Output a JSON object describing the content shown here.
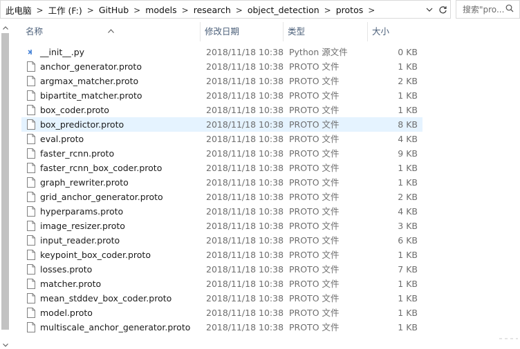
{
  "address_bar": {
    "breadcrumbs": [
      "此电脑",
      "工作 (F:)",
      "GitHub",
      "models",
      "research",
      "object_detection",
      "protos"
    ],
    "separator": ">"
  },
  "search": {
    "placeholder": "搜索\"pro..."
  },
  "columns": {
    "name": "名称",
    "date": "修改日期",
    "type": "类型",
    "size": "大小"
  },
  "files": [
    {
      "name": "__init__.py",
      "date": "2018/11/18 10:38",
      "type": "Python 源文件",
      "size": "0 KB",
      "icon": "python-file-icon"
    },
    {
      "name": "anchor_generator.proto",
      "date": "2018/11/18 10:38",
      "type": "PROTO 文件",
      "size": "1 KB",
      "icon": "file-icon"
    },
    {
      "name": "argmax_matcher.proto",
      "date": "2018/11/18 10:38",
      "type": "PROTO 文件",
      "size": "2 KB",
      "icon": "file-icon"
    },
    {
      "name": "bipartite_matcher.proto",
      "date": "2018/11/18 10:38",
      "type": "PROTO 文件",
      "size": "1 KB",
      "icon": "file-icon"
    },
    {
      "name": "box_coder.proto",
      "date": "2018/11/18 10:38",
      "type": "PROTO 文件",
      "size": "1 KB",
      "icon": "file-icon"
    },
    {
      "name": "box_predictor.proto",
      "date": "2018/11/18 10:38",
      "type": "PROTO 文件",
      "size": "8 KB",
      "icon": "file-icon",
      "selected": true
    },
    {
      "name": "eval.proto",
      "date": "2018/11/18 10:38",
      "type": "PROTO 文件",
      "size": "4 KB",
      "icon": "file-icon"
    },
    {
      "name": "faster_rcnn.proto",
      "date": "2018/11/18 10:38",
      "type": "PROTO 文件",
      "size": "9 KB",
      "icon": "file-icon"
    },
    {
      "name": "faster_rcnn_box_coder.proto",
      "date": "2018/11/18 10:38",
      "type": "PROTO 文件",
      "size": "1 KB",
      "icon": "file-icon"
    },
    {
      "name": "graph_rewriter.proto",
      "date": "2018/11/18 10:38",
      "type": "PROTO 文件",
      "size": "1 KB",
      "icon": "file-icon"
    },
    {
      "name": "grid_anchor_generator.proto",
      "date": "2018/11/18 10:38",
      "type": "PROTO 文件",
      "size": "2 KB",
      "icon": "file-icon"
    },
    {
      "name": "hyperparams.proto",
      "date": "2018/11/18 10:38",
      "type": "PROTO 文件",
      "size": "4 KB",
      "icon": "file-icon"
    },
    {
      "name": "image_resizer.proto",
      "date": "2018/11/18 10:38",
      "type": "PROTO 文件",
      "size": "3 KB",
      "icon": "file-icon"
    },
    {
      "name": "input_reader.proto",
      "date": "2018/11/18 10:38",
      "type": "PROTO 文件",
      "size": "6 KB",
      "icon": "file-icon"
    },
    {
      "name": "keypoint_box_coder.proto",
      "date": "2018/11/18 10:38",
      "type": "PROTO 文件",
      "size": "1 KB",
      "icon": "file-icon"
    },
    {
      "name": "losses.proto",
      "date": "2018/11/18 10:38",
      "type": "PROTO 文件",
      "size": "7 KB",
      "icon": "file-icon"
    },
    {
      "name": "matcher.proto",
      "date": "2018/11/18 10:38",
      "type": "PROTO 文件",
      "size": "1 KB",
      "icon": "file-icon"
    },
    {
      "name": "mean_stddev_box_coder.proto",
      "date": "2018/11/18 10:38",
      "type": "PROTO 文件",
      "size": "1 KB",
      "icon": "file-icon"
    },
    {
      "name": "model.proto",
      "date": "2018/11/18 10:38",
      "type": "PROTO 文件",
      "size": "1 KB",
      "icon": "file-icon"
    },
    {
      "name": "multiscale_anchor_generator.proto",
      "date": "2018/11/18 10:38",
      "type": "PROTO 文件",
      "size": "1 KB",
      "icon": "file-icon"
    }
  ],
  "colors": {
    "selected_row": "#e5f3ff",
    "header_text": "#4c607a",
    "secondary_text": "#6d6d6d",
    "scrollbar_thumb": "#c2c2c2"
  }
}
